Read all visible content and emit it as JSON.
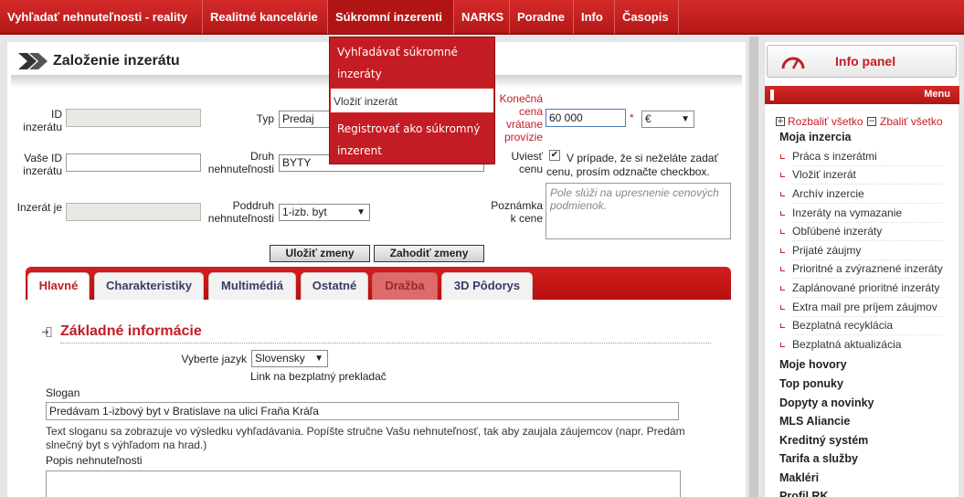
{
  "nav": {
    "items": [
      "Vyhľadať nehnuteľnosti - reality",
      "Realitné kancelárie",
      "Súkromní inzerenti",
      "NARKS",
      "Poradne",
      "Info",
      "Časopis"
    ]
  },
  "dropdown": {
    "items": [
      "Vyhľadávať súkromné inzeráty",
      "Vložiť inzerát",
      "Registrovať ako súkromný inzerent"
    ]
  },
  "page": {
    "title": "Založenie inzerátu"
  },
  "form": {
    "id_label": "ID inzerátu",
    "your_id_label": "Vaše ID inzerátu",
    "ad_is_label": "Inzerát je",
    "type_label": "Typ",
    "type_value": "Predaj",
    "kind_label": "Druh nehnuteľnosti",
    "kind_value": "BYTY",
    "subkind_label": "Poddruh nehnuteľnosti",
    "subkind_value": "1-izb. byt",
    "final_price_label": "Konečná cena vrátane provízie",
    "price_value": "60 000",
    "required_mark": "*",
    "currency_value": "€",
    "show_price_label": "Uviesť cenu",
    "show_price_hint": "V prípade, že si neželáte zadať cenu, prosím odznačte checkbox.",
    "price_note_label": "Poznámka k cene",
    "price_note_placeholder": "Pole slúži na upresnenie cenových podmienok.",
    "save_button": "Uložiť zmeny",
    "discard_button": "Zahodiť zmeny"
  },
  "tabs": [
    "Hlavné",
    "Charakteristiky",
    "Multimédiá",
    "Ostatné",
    "Dražba",
    "3D Pôdorys"
  ],
  "basic": {
    "heading": "Základné informácie",
    "lang_label": "Vyberte jazyk",
    "lang_value": "Slovensky",
    "translator_link": "Link na bezplatný prekladač",
    "slogan_label": "Slogan",
    "slogan_value": "Predávam 1-izbový byt v Bratislave na ulici Fraňa Kráľa",
    "slogan_help": "Text sloganu sa zobrazuje vo výsledku vyhľadávania. Popíšte stručne Vašu nehnuteľnosť, tak aby zaujala záujemcov (napr. Predám slnečný byt s výhľadom na hrad.)",
    "desc_label": "Popis nehnuteľnosti"
  },
  "sidebar": {
    "info_panel": "Info panel",
    "menu": "Menu",
    "expand_all": "Rozbaliť všetko",
    "collapse_all": "Zbaliť všetko",
    "sections": [
      {
        "label": "Moja inzercia"
      },
      {
        "label": "Práca s inzerátmi"
      },
      {
        "label": "Vložiť inzerát"
      },
      {
        "label": "Archív inzercie"
      },
      {
        "label": "Inzeráty na vymazanie"
      },
      {
        "label": "Obľúbené inzeráty"
      },
      {
        "label": "Prijaté záujmy"
      },
      {
        "label": "Prioritné a zvýraznené inzeráty"
      },
      {
        "label": "Zaplánované prioritné inzeráty"
      },
      {
        "label": "Extra mail pre príjem záujmov"
      },
      {
        "label": "Bezplatná recyklácia"
      },
      {
        "label": "Bezplatná aktualizácia"
      },
      {
        "label": "Moje hovory"
      },
      {
        "label": "Top ponuky"
      },
      {
        "label": "Dopyty a novinky"
      },
      {
        "label": "MLS Aliancie"
      },
      {
        "label": "Kreditný systém"
      },
      {
        "label": "Tarifa a služby"
      },
      {
        "label": "Makléri"
      },
      {
        "label": "Profil RK"
      }
    ]
  },
  "colors": {
    "brand": "#c41c24",
    "nav_bg": "#c8201f"
  },
  "icons": {
    "title": "double-chevron-right-icon",
    "info": "speedometer-icon",
    "expand": "plus-box-icon",
    "collapse": "minus-box-icon"
  }
}
